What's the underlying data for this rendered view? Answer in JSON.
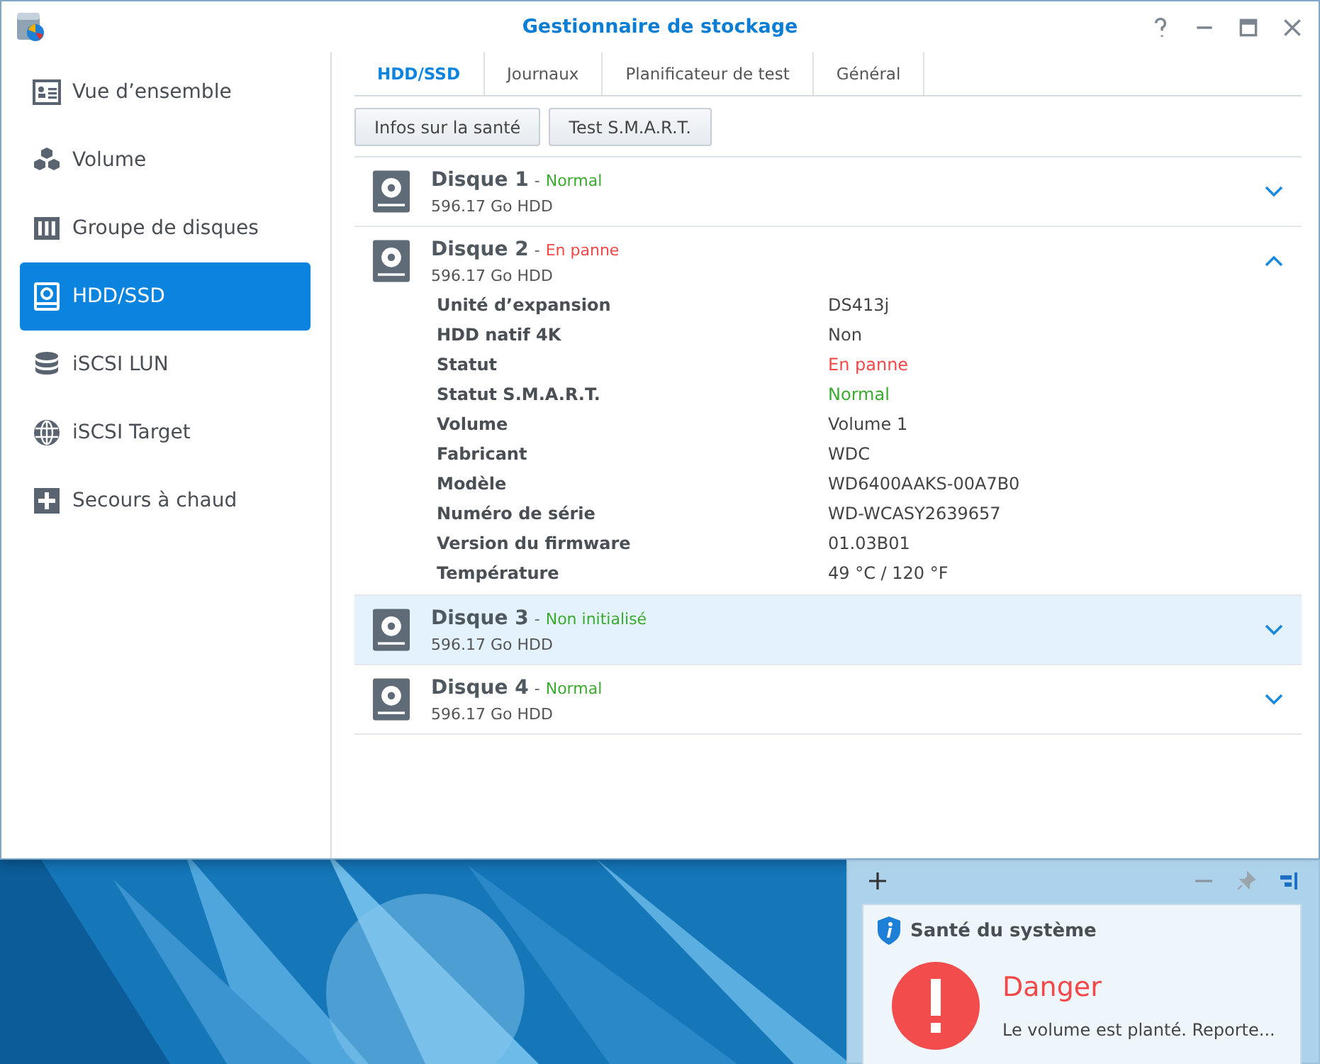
{
  "window": {
    "title": "Gestionnaire de stockage"
  },
  "sidebar": {
    "items": [
      {
        "label": "Vue d’ensemble",
        "kind": "overview",
        "selected": false
      },
      {
        "label": "Volume",
        "kind": "volume",
        "selected": false
      },
      {
        "label": "Groupe de disques",
        "kind": "group",
        "selected": false
      },
      {
        "label": "HDD/SSD",
        "kind": "hdd",
        "selected": true
      },
      {
        "label": "iSCSI LUN",
        "kind": "lun",
        "selected": false
      },
      {
        "label": "iSCSI Target",
        "kind": "target",
        "selected": false
      },
      {
        "label": "Secours à chaud",
        "kind": "spare",
        "selected": false
      }
    ]
  },
  "tabs": [
    {
      "label": "HDD/SSD",
      "selected": true
    },
    {
      "label": "Journaux",
      "selected": false
    },
    {
      "label": "Planificateur de test",
      "selected": false
    },
    {
      "label": "Général",
      "selected": false
    }
  ],
  "buttons": [
    "Infos sur la santé",
    "Test S.M.A.R.T."
  ],
  "disks": [
    {
      "name": "Disque 1",
      "separator": "-",
      "status": "Normal",
      "color": "#3aab2e",
      "size": "596.17 Go HDD",
      "expanded": false,
      "selected": false
    },
    {
      "name": "Disque 2",
      "separator": "-",
      "status": "En panne",
      "color": "#f24848",
      "size": "596.17 Go HDD",
      "expanded": true,
      "selected": false,
      "details": [
        {
          "label": "Unité d’expansion",
          "value": "DS413j",
          "color": "#444444"
        },
        {
          "label": "HDD natif 4K",
          "value": "Non",
          "color": "#444444"
        },
        {
          "label": "Statut",
          "value": "En panne",
          "color": "#f24848"
        },
        {
          "label": "Statut S.M.A.R.T.",
          "value": "Normal",
          "color": "#3aab2e"
        },
        {
          "label": "Volume",
          "value": "Volume 1",
          "color": "#444444"
        },
        {
          "label": "Fabricant",
          "value": "WDC",
          "color": "#444444"
        },
        {
          "label": "Modèle",
          "value": "WD6400AAKS-00A7B0",
          "color": "#444444"
        },
        {
          "label": "Numéro de série",
          "value": "WD-WCASY2639657",
          "color": "#444444"
        },
        {
          "label": "Version du firmware",
          "value": "01.03B01",
          "color": "#444444"
        },
        {
          "label": "Température",
          "value": "49 °C / 120 °F",
          "color": "#444444"
        }
      ]
    },
    {
      "name": "Disque 3",
      "separator": "-",
      "status": "Non initialisé",
      "color": "#3aab2e",
      "size": "596.17 Go HDD",
      "expanded": false,
      "selected": true
    },
    {
      "name": "Disque 4",
      "separator": "-",
      "status": "Normal",
      "color": "#3aab2e",
      "size": "596.17 Go HDD",
      "expanded": false,
      "selected": false
    }
  ],
  "widget": {
    "title": "Santé du système",
    "status": "Danger",
    "message": "Le volume est planté. Reporte..."
  }
}
